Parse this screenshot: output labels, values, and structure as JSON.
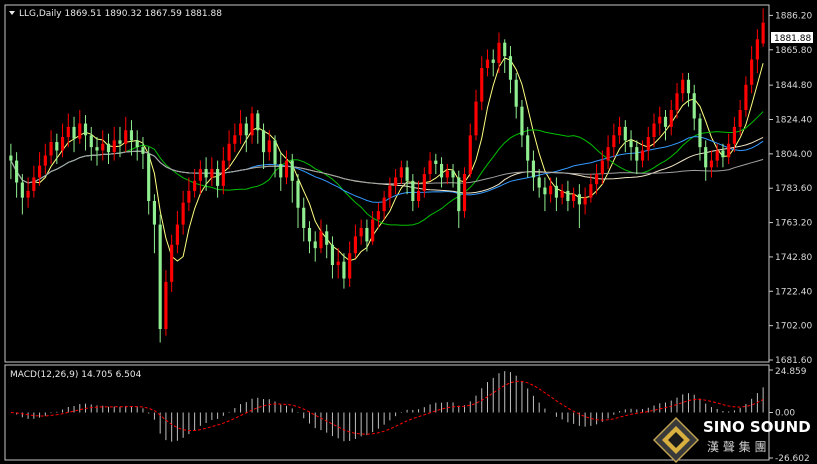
{
  "chart_data": [
    {
      "type": "candlestick",
      "symbol": "LLG",
      "timeframe": "Daily",
      "header": "LLG,Daily  1869.51 1890.32 1867.59 1881.88",
      "ohlc_last": {
        "open": 1869.51,
        "high": 1890.32,
        "low": 1867.59,
        "close": 1881.88
      },
      "current_price_label": "1881.88",
      "y_ticks": [
        "1886.20",
        "1865.80",
        "1844.80",
        "1824.40",
        "1804.00",
        "1783.60",
        "1763.20",
        "1742.80",
        "1722.40",
        "1702.00",
        "1681.60"
      ],
      "ylim": [
        1681.6,
        1890.6
      ],
      "up_color": "#ff0000",
      "down_color": "#90ee90",
      "moving_average_colors": [
        "#ffff80",
        "#00c000",
        "#3399ff",
        "#f0e6c8",
        "#a0a0a0"
      ],
      "candles": [
        [
          1803,
          1800,
          1789,
          1810
        ],
        [
          1800,
          1787,
          1778,
          1805
        ],
        [
          1787,
          1778,
          1768,
          1792
        ],
        [
          1778,
          1782,
          1772,
          1790
        ],
        [
          1782,
          1790,
          1778,
          1797
        ],
        [
          1790,
          1797,
          1785,
          1805
        ],
        [
          1797,
          1803,
          1792,
          1810
        ],
        [
          1803,
          1811,
          1798,
          1818
        ],
        [
          1811,
          1806,
          1798,
          1816
        ],
        [
          1806,
          1814,
          1802,
          1822
        ],
        [
          1814,
          1820,
          1808,
          1828
        ],
        [
          1820,
          1813,
          1805,
          1826
        ],
        [
          1813,
          1822,
          1810,
          1830
        ],
        [
          1822,
          1815,
          1806,
          1827
        ],
        [
          1815,
          1808,
          1800,
          1820
        ],
        [
          1808,
          1806,
          1797,
          1814
        ],
        [
          1806,
          1810,
          1800,
          1818
        ],
        [
          1810,
          1805,
          1798,
          1816
        ],
        [
          1805,
          1812,
          1800,
          1820
        ],
        [
          1812,
          1810,
          1802,
          1820
        ],
        [
          1810,
          1818,
          1805,
          1826
        ],
        [
          1818,
          1812,
          1803,
          1824
        ],
        [
          1812,
          1808,
          1800,
          1818
        ],
        [
          1808,
          1804,
          1795,
          1814
        ],
        [
          1804,
          1776,
          1768,
          1808
        ],
        [
          1776,
          1762,
          1745,
          1780
        ],
        [
          1762,
          1700,
          1692,
          1768
        ],
        [
          1700,
          1728,
          1696,
          1735
        ],
        [
          1728,
          1750,
          1722,
          1756
        ],
        [
          1750,
          1762,
          1745,
          1770
        ],
        [
          1762,
          1775,
          1756,
          1782
        ],
        [
          1775,
          1782,
          1770,
          1790
        ],
        [
          1782,
          1788,
          1778,
          1795
        ],
        [
          1788,
          1795,
          1780,
          1800
        ],
        [
          1795,
          1790,
          1782,
          1802
        ],
        [
          1790,
          1795,
          1785,
          1802
        ],
        [
          1795,
          1785,
          1778,
          1800
        ],
        [
          1785,
          1800,
          1780,
          1808
        ],
        [
          1800,
          1810,
          1795,
          1818
        ],
        [
          1810,
          1815,
          1805,
          1822
        ],
        [
          1815,
          1822,
          1810,
          1830
        ],
        [
          1822,
          1815,
          1805,
          1826
        ],
        [
          1815,
          1828,
          1810,
          1832
        ],
        [
          1828,
          1818,
          1810,
          1830
        ],
        [
          1818,
          1805,
          1795,
          1822
        ],
        [
          1805,
          1812,
          1800,
          1818
        ],
        [
          1812,
          1798,
          1790,
          1815
        ],
        [
          1798,
          1790,
          1782,
          1805
        ],
        [
          1790,
          1800,
          1786,
          1806
        ],
        [
          1800,
          1788,
          1775,
          1804
        ],
        [
          1788,
          1772,
          1760,
          1792
        ],
        [
          1772,
          1760,
          1752,
          1778
        ],
        [
          1760,
          1752,
          1745,
          1764
        ],
        [
          1752,
          1748,
          1740,
          1758
        ],
        [
          1748,
          1758,
          1745,
          1765
        ],
        [
          1758,
          1750,
          1742,
          1762
        ],
        [
          1750,
          1738,
          1730,
          1755
        ],
        [
          1738,
          1740,
          1730,
          1748
        ],
        [
          1740,
          1730,
          1724,
          1745
        ],
        [
          1730,
          1745,
          1725,
          1752
        ],
        [
          1745,
          1755,
          1742,
          1762
        ],
        [
          1755,
          1760,
          1750,
          1765
        ],
        [
          1760,
          1752,
          1746,
          1765
        ],
        [
          1752,
          1765,
          1750,
          1770
        ],
        [
          1765,
          1770,
          1760,
          1775
        ],
        [
          1770,
          1778,
          1765,
          1782
        ],
        [
          1778,
          1785,
          1772,
          1790
        ],
        [
          1785,
          1790,
          1780,
          1795
        ],
        [
          1790,
          1796,
          1786,
          1800
        ],
        [
          1796,
          1788,
          1780,
          1800
        ],
        [
          1788,
          1776,
          1770,
          1792
        ],
        [
          1776,
          1782,
          1772,
          1788
        ],
        [
          1782,
          1792,
          1778,
          1796
        ],
        [
          1792,
          1800,
          1788,
          1805
        ],
        [
          1800,
          1798,
          1792,
          1804
        ],
        [
          1798,
          1790,
          1784,
          1802
        ],
        [
          1790,
          1794,
          1786,
          1798
        ],
        [
          1794,
          1790,
          1784,
          1798
        ],
        [
          1790,
          1770,
          1760,
          1794
        ],
        [
          1770,
          1792,
          1766,
          1796
        ],
        [
          1792,
          1815,
          1790,
          1822
        ],
        [
          1815,
          1835,
          1812,
          1842
        ],
        [
          1835,
          1855,
          1830,
          1862
        ],
        [
          1855,
          1860,
          1850,
          1866
        ],
        [
          1860,
          1858,
          1850,
          1866
        ],
        [
          1858,
          1870,
          1852,
          1876
        ],
        [
          1870,
          1862,
          1852,
          1872
        ],
        [
          1862,
          1848,
          1840,
          1868
        ],
        [
          1848,
          1832,
          1825,
          1852
        ],
        [
          1832,
          1815,
          1808,
          1836
        ],
        [
          1815,
          1800,
          1790,
          1820
        ],
        [
          1800,
          1790,
          1782,
          1806
        ],
        [
          1790,
          1784,
          1778,
          1795
        ],
        [
          1784,
          1780,
          1770,
          1790
        ],
        [
          1780,
          1785,
          1775,
          1790
        ],
        [
          1785,
          1778,
          1770,
          1790
        ],
        [
          1778,
          1782,
          1774,
          1786
        ],
        [
          1782,
          1776,
          1770,
          1788
        ],
        [
          1776,
          1780,
          1772,
          1784
        ],
        [
          1780,
          1774,
          1760,
          1786
        ],
        [
          1774,
          1778,
          1768,
          1784
        ],
        [
          1778,
          1786,
          1775,
          1792
        ],
        [
          1786,
          1792,
          1780,
          1798
        ],
        [
          1792,
          1800,
          1786,
          1806
        ],
        [
          1800,
          1808,
          1795,
          1815
        ],
        [
          1808,
          1815,
          1802,
          1822
        ],
        [
          1815,
          1820,
          1810,
          1826
        ],
        [
          1820,
          1812,
          1805,
          1824
        ],
        [
          1812,
          1808,
          1800,
          1818
        ],
        [
          1808,
          1800,
          1792,
          1812
        ],
        [
          1800,
          1806,
          1796,
          1812
        ],
        [
          1806,
          1814,
          1800,
          1820
        ],
        [
          1814,
          1822,
          1808,
          1828
        ],
        [
          1822,
          1826,
          1815,
          1832
        ],
        [
          1826,
          1820,
          1812,
          1830
        ],
        [
          1820,
          1830,
          1815,
          1836
        ],
        [
          1830,
          1840,
          1825,
          1846
        ],
        [
          1840,
          1848,
          1835,
          1852
        ],
        [
          1848,
          1840,
          1832,
          1852
        ],
        [
          1840,
          1825,
          1818,
          1845
        ],
        [
          1825,
          1808,
          1800,
          1828
        ],
        [
          1808,
          1796,
          1788,
          1812
        ],
        [
          1796,
          1800,
          1790,
          1806
        ],
        [
          1800,
          1806,
          1796,
          1810
        ],
        [
          1806,
          1802,
          1796,
          1810
        ],
        [
          1802,
          1810,
          1798,
          1816
        ],
        [
          1810,
          1820,
          1805,
          1826
        ],
        [
          1820,
          1830,
          1815,
          1836
        ],
        [
          1830,
          1845,
          1826,
          1850
        ],
        [
          1845,
          1860,
          1840,
          1868
        ],
        [
          1860,
          1872,
          1852,
          1878
        ],
        [
          1869.51,
          1881.88,
          1867.59,
          1890.32
        ]
      ],
      "macd": {
        "label": "MACD(12,26,9) 14.705 6.504",
        "params": [
          12,
          26,
          9
        ],
        "main": 14.705,
        "signal": 6.504,
        "y_ticks": [
          "24.859",
          "0.00",
          "-26.602"
        ],
        "ylim": [
          -26.602,
          24.859
        ],
        "histogram_color": "#c0c0c0",
        "signal_color": "#ff0000"
      }
    }
  ],
  "watermark": {
    "brand": "SINO SOUND",
    "subtitle": "漢 聲 集 團"
  }
}
